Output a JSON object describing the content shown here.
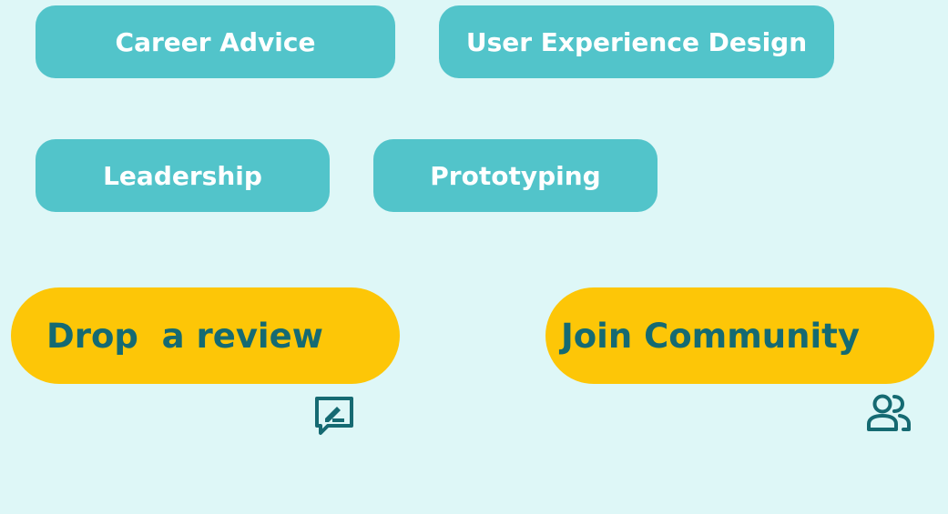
{
  "tags": {
    "career_advice": "Career Advice",
    "user_experience_design": "User Experience Design",
    "leadership": "Leadership",
    "prototyping": "Prototyping"
  },
  "actions": {
    "drop_review": {
      "label": "Drop  a review",
      "icon": "edit-review-icon"
    },
    "join_community": {
      "label": "Join Community",
      "icon": "people-group-icon"
    }
  },
  "colors": {
    "background": "#def7f7",
    "tag_background": "#52c4ca",
    "tag_text": "#ffffff",
    "action_background": "#fdc607",
    "action_text": "#156a72"
  }
}
